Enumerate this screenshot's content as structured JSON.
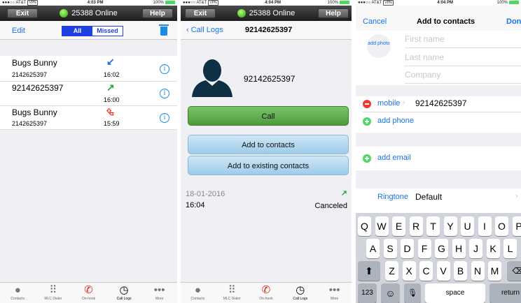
{
  "screen1": {
    "status": {
      "carrier": "●●●○○ AT&T",
      "time": "4:03 PM",
      "battery": "100%"
    },
    "sip": {
      "exit": "Exit",
      "status": "25388 Online",
      "help": "Help"
    },
    "nav": {
      "edit": "Edit",
      "all": "All",
      "missed": "Missed"
    },
    "calls": [
      {
        "name": "Bugs Bunny",
        "number": "2142625397",
        "time": "16:02",
        "arrow": "↙",
        "arrow_color": "#1a6fe8"
      },
      {
        "name": "92142625397",
        "number": "",
        "time": "16:00",
        "arrow": "↗",
        "arrow_color": "#21a83a"
      },
      {
        "name": "Bugs Bunny",
        "number": "2142625397",
        "time": "15:59",
        "arrow": "⮴",
        "arrow_color": "#e8261a"
      }
    ],
    "tabs": [
      "Contacts",
      "MLC Dialer",
      "On-hook",
      "Call Logs",
      "More"
    ]
  },
  "screen2": {
    "status": {
      "carrier": "●●●○○ AT&T",
      "time": "4:04 PM",
      "battery": "100%"
    },
    "sip": {
      "exit": "Exit",
      "status": "25388 Online",
      "help": "Help"
    },
    "nav": {
      "back": "Call Logs",
      "title": "92142625397"
    },
    "contact_number": "92142625397",
    "call_button": "Call",
    "add_contacts": "Add to contacts",
    "add_existing": "Add to existing contacts",
    "log": {
      "date": "18-01-2016",
      "time": "16:04",
      "status": "Canceled"
    },
    "tabs": [
      "Contacts",
      "MLC Dialer",
      "On-hook",
      "Call Logs",
      "More"
    ]
  },
  "screen3": {
    "status": {
      "carrier": "●●●○○ AT&T",
      "time": "4:04 PM",
      "battery": "100%"
    },
    "nav": {
      "cancel": "Cancel",
      "title": "Add to contacts",
      "done": "Done"
    },
    "add_photo": "add photo",
    "placeholders": {
      "first": "First name",
      "last": "Last name",
      "company": "Company"
    },
    "phone_label": "mobile",
    "phone_value": "92142625397",
    "add_phone": "add phone",
    "add_email": "add email",
    "ringtone_label": "Ringtone",
    "ringtone_value": "Default",
    "keyboard": {
      "row1": [
        "Q",
        "W",
        "E",
        "R",
        "T",
        "Y",
        "U",
        "I",
        "O",
        "P"
      ],
      "row2": [
        "A",
        "S",
        "D",
        "F",
        "G",
        "H",
        "J",
        "K",
        "L"
      ],
      "row3": [
        "Z",
        "X",
        "C",
        "V",
        "B",
        "N",
        "M"
      ],
      "num": "123",
      "space": "space",
      "return": "return"
    }
  }
}
